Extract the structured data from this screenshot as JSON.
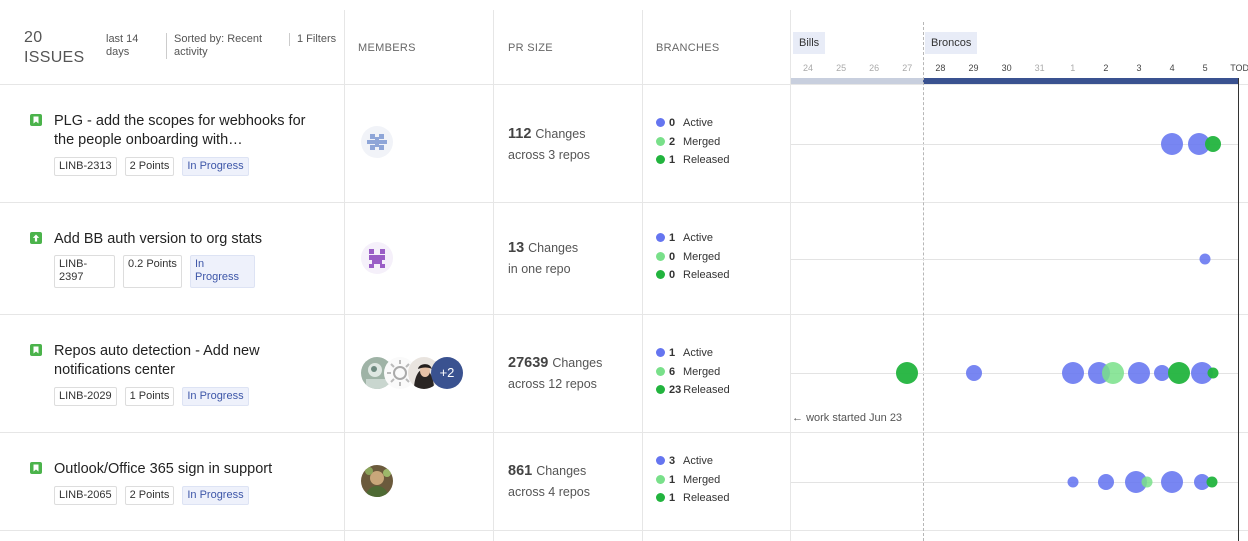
{
  "header": {
    "issue_count": "20 ISSUES",
    "period": "last 14 days",
    "sort": "Sorted by: Recent activity",
    "filters": "1 Filters",
    "col_members": "MEMBERS",
    "col_pr_size": "PR SIZE",
    "col_branches": "BRANCHES"
  },
  "timeline": {
    "sprints": [
      "Bills",
      "Broncos"
    ],
    "days": [
      "24",
      "25",
      "26",
      "27",
      "28",
      "29",
      "30",
      "31",
      "1",
      "2",
      "3",
      "4",
      "5",
      "TODAY"
    ],
    "work_started": "work started Jun 23"
  },
  "branch_labels": {
    "active": "Active",
    "merged": "Merged",
    "released": "Released"
  },
  "issues": [
    {
      "type": "story",
      "title": "PLG - add the scopes for webhooks for the people onboarding with…",
      "key": "LINB-2313",
      "points": "2 Points",
      "status": "In Progress",
      "changes": "112",
      "changes_label": "Changes",
      "repos": "across 3 repos",
      "branches": {
        "active": "0",
        "merged": "2",
        "released": "1"
      },
      "events": [
        {
          "day": 4,
          "size": 22,
          "kind": "active"
        },
        {
          "day": 4.8,
          "size": 22,
          "kind": "active"
        },
        {
          "day": 5.25,
          "size": 16,
          "kind": "released"
        }
      ]
    },
    {
      "type": "improvement",
      "title": "Add BB auth version to org stats",
      "key": "LINB-2397",
      "points": "0.2 Points",
      "status": "In Progress",
      "changes": "13",
      "changes_label": "Changes",
      "repos": "in one repo",
      "branches": {
        "active": "1",
        "merged": "0",
        "released": "0"
      },
      "events": [
        {
          "day": 5,
          "size": 11,
          "kind": "active"
        }
      ]
    },
    {
      "type": "story",
      "title": "Repos auto detection - Add new notifications center",
      "key": "LINB-2029",
      "points": "1 Points",
      "status": "In Progress",
      "changes": "27639",
      "changes_label": "Changes",
      "repos": "across 12 repos",
      "branches": {
        "active": "1",
        "merged": "6",
        "released": "23"
      },
      "events": [
        {
          "day": -4,
          "size": 22,
          "kind": "released"
        },
        {
          "day": -2,
          "size": 16,
          "kind": "active"
        },
        {
          "day": 1,
          "size": 22,
          "kind": "active"
        },
        {
          "day": 1.8,
          "size": 22,
          "kind": "active"
        },
        {
          "day": 2.2,
          "size": 22,
          "kind": "merged"
        },
        {
          "day": 3,
          "size": 22,
          "kind": "active"
        },
        {
          "day": 3.7,
          "size": 16,
          "kind": "active"
        },
        {
          "day": 4.2,
          "size": 22,
          "kind": "released"
        },
        {
          "day": 4.9,
          "size": 22,
          "kind": "active"
        },
        {
          "day": 5.25,
          "size": 11,
          "kind": "released"
        }
      ]
    },
    {
      "type": "story",
      "title": "Outlook/Office 365 sign in support",
      "key": "LINB-2065",
      "points": "2 Points",
      "status": "In Progress",
      "changes": "861",
      "changes_label": "Changes",
      "repos": "across 4 repos",
      "branches": {
        "active": "3",
        "merged": "1",
        "released": "1"
      },
      "events": [
        {
          "day": 1,
          "size": 11,
          "kind": "active"
        },
        {
          "day": 2,
          "size": 16,
          "kind": "active"
        },
        {
          "day": 2.9,
          "size": 22,
          "kind": "active"
        },
        {
          "day": 3.25,
          "size": 11,
          "kind": "merged"
        },
        {
          "day": 4,
          "size": 22,
          "kind": "active"
        },
        {
          "day": 4.9,
          "size": 16,
          "kind": "active"
        },
        {
          "day": 5.2,
          "size": 11,
          "kind": "released"
        }
      ]
    }
  ]
}
